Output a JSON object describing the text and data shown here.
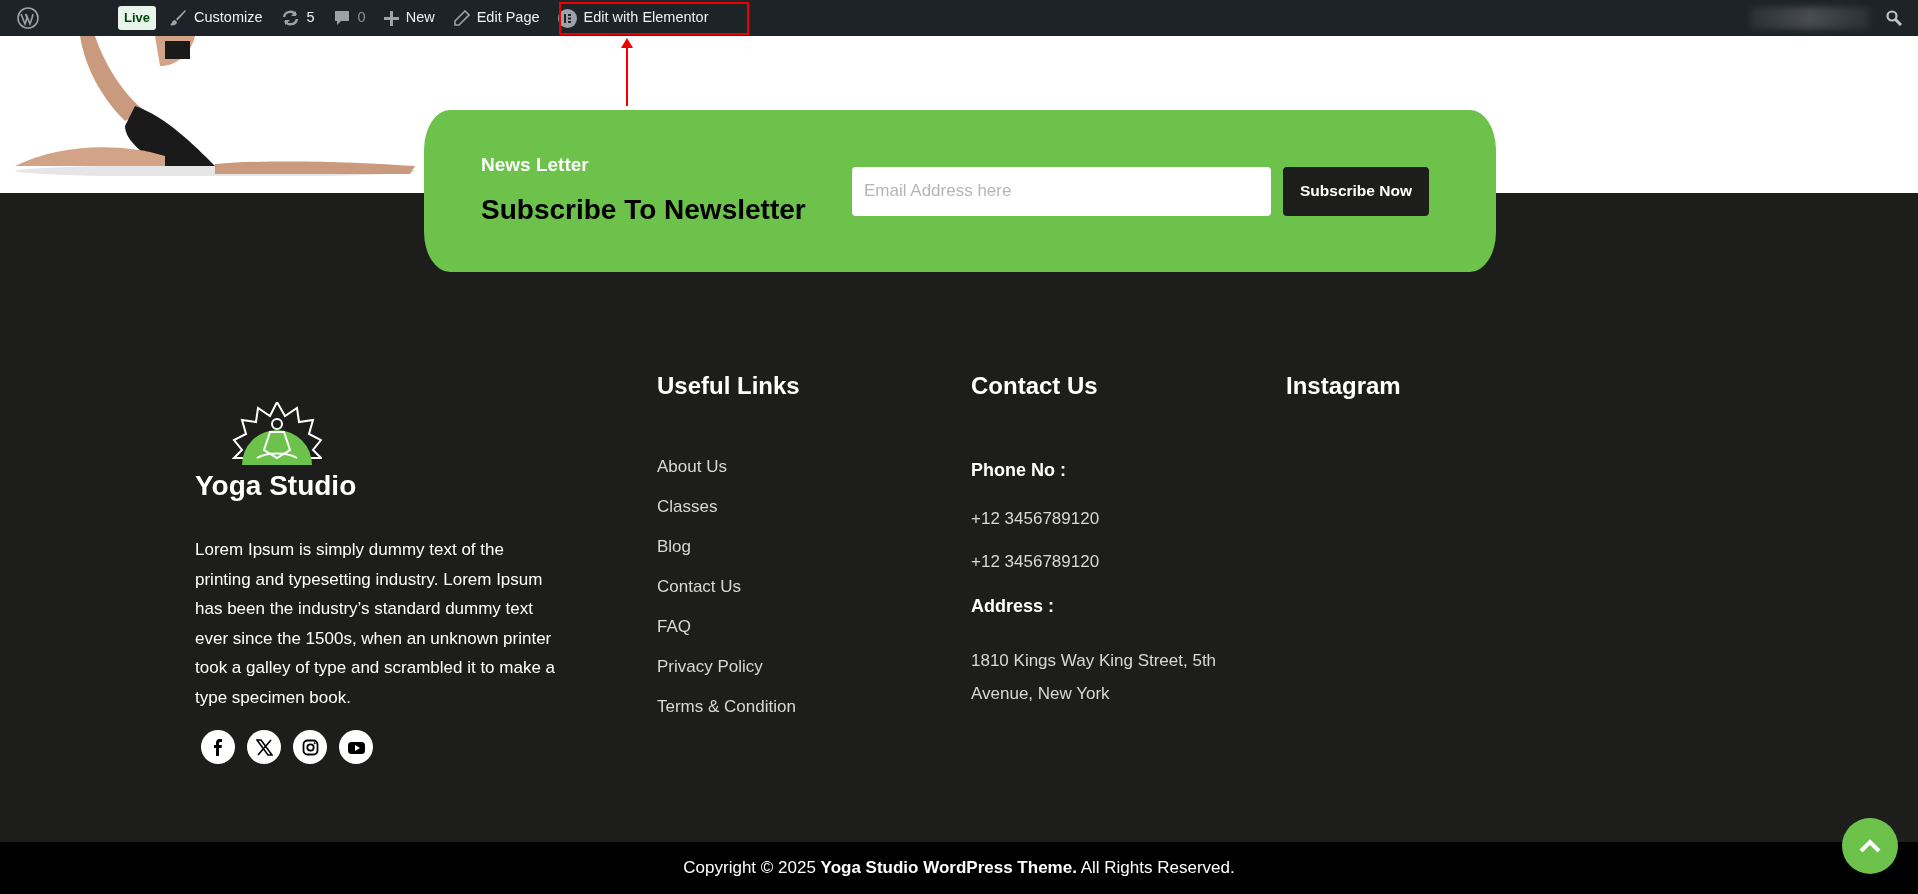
{
  "admin_bar": {
    "items": [
      {
        "kind": "wp"
      },
      {
        "kind": "badge",
        "label": "Live"
      },
      {
        "kind": "brush",
        "label": "Customize"
      },
      {
        "kind": "updates",
        "label": "5"
      },
      {
        "kind": "comments",
        "label": "0",
        "disabled": true
      },
      {
        "kind": "plus",
        "label": "New"
      },
      {
        "kind": "pencil",
        "label": "Edit Page"
      },
      {
        "kind": "elementor",
        "label": "Edit with Elementor",
        "highlighted": true
      }
    ]
  },
  "newsletter": {
    "eyebrow": "News Letter",
    "title": "Subscribe To Newsletter",
    "email": {
      "placeholder": "Email Address here"
    },
    "button": "Subscribe Now"
  },
  "footer": {
    "brand": {
      "name": "Yoga Studio",
      "description": "Lorem Ipsum is simply dummy text of the printing and typesetting industry. Lorem Ipsum has been the industry’s standard dummy text ever since the 1500s, when an unknown printer took a galley of type and scrambled it to make a type specimen book."
    },
    "social": [
      {
        "kind": "facebook"
      },
      {
        "kind": "x"
      },
      {
        "kind": "instagram"
      },
      {
        "kind": "youtube"
      }
    ],
    "useful_links": {
      "title": "Useful Links",
      "links": [
        "About Us",
        "Classes",
        "Blog",
        "Contact Us",
        "FAQ",
        "Privacy Policy",
        "Terms & Condition"
      ]
    },
    "contact": {
      "title": "Contact Us",
      "phone_label": "Phone No :",
      "phones": [
        "+12 3456789120",
        "+12 3456789120"
      ],
      "address_label": "Address :",
      "address": "1810 Kings Way King Street, 5th Avenue, New York"
    },
    "instagram": {
      "title": "Instagram"
    }
  },
  "copyright": "Copyright © 2025 **Yoga Studio WordPress Theme.** All Rights Reserved."
}
